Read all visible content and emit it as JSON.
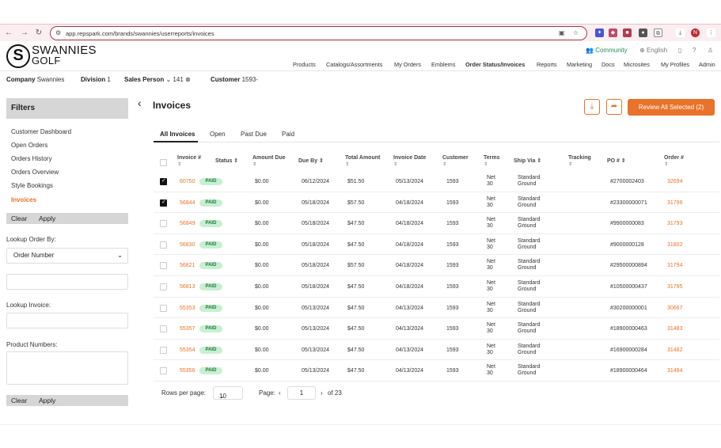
{
  "browser": {
    "url": "app.repspark.com/brands/swannies/userreports/invoices",
    "avatar_letter": "N"
  },
  "brand": {
    "logo_letter": "S",
    "line1": "SWANNIES",
    "line2": "GOLF"
  },
  "utility": {
    "community": "Community",
    "language": "English"
  },
  "nav": [
    "Products",
    "Catalogs/Assortments",
    "My Orders",
    "Emblems",
    "Order Status/Invoices",
    "Reports",
    "Marketing",
    "Docs",
    "Microsites",
    "My Profiles",
    "Admin"
  ],
  "context": {
    "company_label": "Company",
    "company_value": "Swannies",
    "division_label": "Division",
    "division_value": "1",
    "salesperson_label": "Sales Person",
    "salesperson_value": "141",
    "customer_label": "Customer",
    "customer_value": "1593-"
  },
  "sidebar": {
    "title": "Filters",
    "links": [
      "Customer Dashboard",
      "Open Orders",
      "Orders History",
      "Orders Overview",
      "Style Bookings",
      "Invoices"
    ],
    "clear": "Clear",
    "apply": "Apply",
    "lookup_order_label": "Lookup Order By:",
    "lookup_order_value": "Order Number",
    "lookup_invoice_label": "Lookup Invoice:",
    "product_numbers_label": "Product Numbers:"
  },
  "main": {
    "title": "Invoices",
    "review_button": "Review All Selected (2)",
    "tabs": [
      "All Invoices",
      "Open",
      "Past Due",
      "Paid"
    ],
    "columns": [
      "Invoice #",
      "Status",
      "Amount Due",
      "Due By",
      "Total Amount",
      "Invoice Date",
      "Customer",
      "Terms",
      "Ship Via",
      "Tracking",
      "PO #",
      "Order #"
    ],
    "sort_glyph": "⇕",
    "rows": [
      {
        "checked": true,
        "invoice": "60750",
        "status": "PAID",
        "amount_due": "$0.00",
        "due_by": "06/12/2024",
        "total": "$51.50",
        "invoice_date": "05/13/2024",
        "customer": "1593",
        "terms1": "Net",
        "terms2": "30",
        "ship1": "Standard",
        "ship2": "Ground",
        "po": "#2700002403",
        "order": "32694"
      },
      {
        "checked": true,
        "invoice": "56844",
        "status": "PAID",
        "amount_due": "$0.00",
        "due_by": "05/18/2024",
        "total": "$57.50",
        "invoice_date": "04/18/2024",
        "customer": "1593",
        "terms1": "Net",
        "terms2": "30",
        "ship1": "Standard",
        "ship2": "Ground",
        "po": "#23300000071",
        "order": "31796"
      },
      {
        "checked": false,
        "invoice": "56849",
        "status": "PAID",
        "amount_due": "$0.00",
        "due_by": "05/18/2024",
        "total": "$47.50",
        "invoice_date": "04/18/2024",
        "customer": "1593",
        "terms1": "Net",
        "terms2": "30",
        "ship1": "Standard",
        "ship2": "Ground",
        "po": "#9900000083",
        "order": "31793"
      },
      {
        "checked": false,
        "invoice": "56830",
        "status": "PAID",
        "amount_due": "$0.00",
        "due_by": "05/18/2024",
        "total": "$47.50",
        "invoice_date": "04/18/2024",
        "customer": "1593",
        "terms1": "Net",
        "terms2": "30",
        "ship1": "Standard",
        "ship2": "Ground",
        "po": "#9000000128",
        "order": "31802"
      },
      {
        "checked": false,
        "invoice": "56821",
        "status": "PAID",
        "amount_due": "$0.00",
        "due_by": "05/18/2024",
        "total": "$57.50",
        "invoice_date": "04/18/2024",
        "customer": "1593",
        "terms1": "Net",
        "terms2": "30",
        "ship1": "Standard",
        "ship2": "Ground",
        "po": "#29500000894",
        "order": "31794"
      },
      {
        "checked": false,
        "invoice": "56813",
        "status": "PAID",
        "amount_due": "$0.00",
        "due_by": "05/18/2024",
        "total": "$47.50",
        "invoice_date": "04/18/2024",
        "customer": "1593",
        "terms1": "Net",
        "terms2": "30",
        "ship1": "Standard",
        "ship2": "Ground",
        "po": "#10500000437",
        "order": "31795"
      },
      {
        "checked": false,
        "invoice": "55353",
        "status": "PAID",
        "amount_due": "$0.00",
        "due_by": "05/13/2024",
        "total": "$47.50",
        "invoice_date": "04/13/2024",
        "customer": "1593",
        "terms1": "Net",
        "terms2": "30",
        "ship1": "Standard",
        "ship2": "Ground",
        "po": "#30200000001",
        "order": "30667"
      },
      {
        "checked": false,
        "invoice": "55357",
        "status": "PAID",
        "amount_due": "$0.00",
        "due_by": "05/13/2024",
        "total": "$47.50",
        "invoice_date": "04/13/2024",
        "customer": "1593",
        "terms1": "Net",
        "terms2": "30",
        "ship1": "Standard",
        "ship2": "Ground",
        "po": "#18900000463",
        "order": "31483"
      },
      {
        "checked": false,
        "invoice": "55354",
        "status": "PAID",
        "amount_due": "$0.00",
        "due_by": "05/13/2024",
        "total": "$47.50",
        "invoice_date": "04/13/2024",
        "customer": "1593",
        "terms1": "Net",
        "terms2": "30",
        "ship1": "Standard",
        "ship2": "Ground",
        "po": "#16900000284",
        "order": "31482"
      },
      {
        "checked": false,
        "invoice": "55356",
        "status": "PAID",
        "amount_due": "$0.00",
        "due_by": "05/13/2024",
        "total": "$47.50",
        "invoice_date": "04/13/2024",
        "customer": "1593",
        "terms1": "Net",
        "terms2": "30",
        "ship1": "Standard",
        "ship2": "Ground",
        "po": "#18900000464",
        "order": "31484"
      }
    ],
    "pager": {
      "rows_per_page_label": "Rows per page:",
      "rows_per_page_value": "10",
      "page_label": "Page:",
      "page_value": "1",
      "of_total": "of 23"
    }
  },
  "colors": {
    "accent": "#e8732a",
    "paid_bg": "#c8efd2",
    "paid_text": "#1e7a3b",
    "url_border": "#b0364b"
  }
}
